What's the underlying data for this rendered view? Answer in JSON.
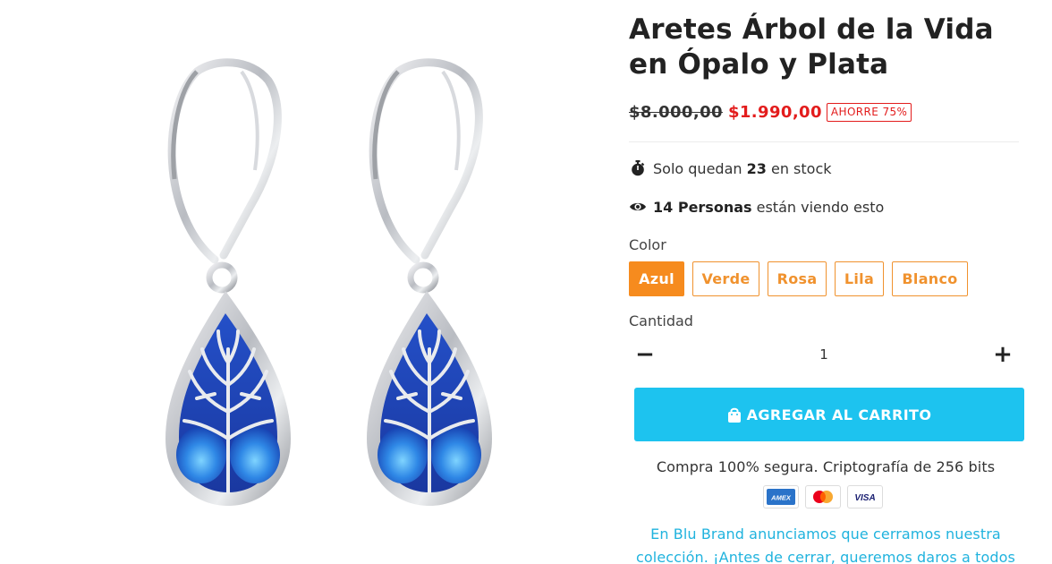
{
  "product": {
    "title": "Aretes Árbol de la Vida en Ópalo y Plata",
    "image_alt": "Aretes Árbol de la Vida en Ópalo y Plata"
  },
  "price": {
    "compare": "$8.000,00",
    "current": "$1.990,00",
    "badge": "AHORRE 75%"
  },
  "stock": {
    "prefix": "Solo quedan",
    "count": "23",
    "suffix": "en stock"
  },
  "viewers": {
    "count": "14 Personas",
    "suffix": "están viendo esto"
  },
  "color": {
    "label": "Color",
    "options": [
      "Azul",
      "Verde",
      "Rosa",
      "Lila",
      "Blanco"
    ],
    "selected": "Azul"
  },
  "quantity": {
    "label": "Cantidad",
    "minus": "−",
    "value": "1",
    "plus": "+"
  },
  "cart": {
    "button_label": "AGREGAR AL CARRITO"
  },
  "secure_text": "Compra 100% segura. Criptografía de 256 bits",
  "payments": [
    "AMEX",
    "Mastercard",
    "VISA"
  ],
  "promo": {
    "line1": "En Blu Brand anunciamos que cerramos nuestra",
    "line2": "colección. ¡Antes de cerrar, queremos daros a todos"
  },
  "colors": {
    "accent": "#f68b1e",
    "sale": "#e31c1c",
    "cta": "#1dc3ef",
    "link": "#20b3de"
  }
}
